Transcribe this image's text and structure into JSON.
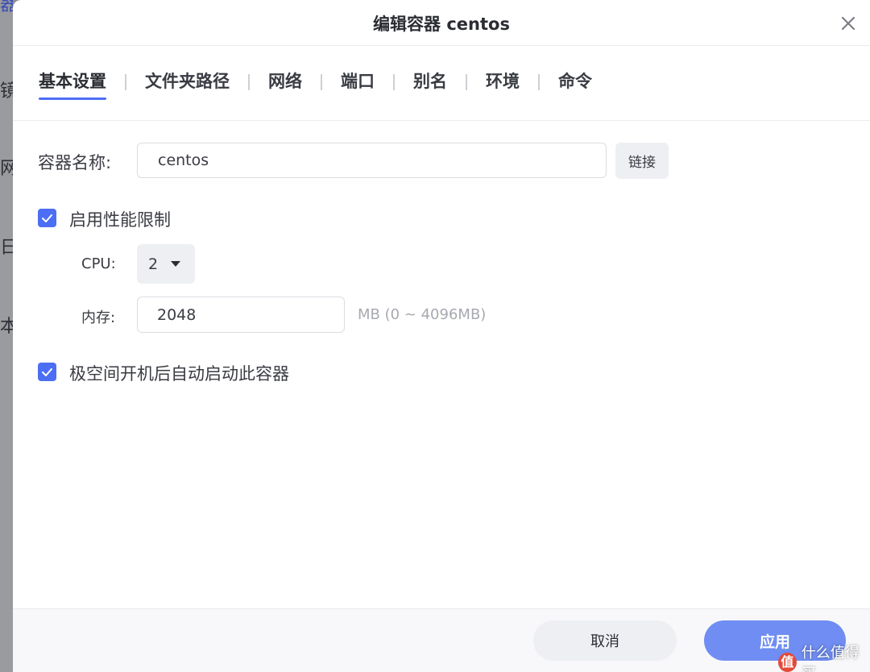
{
  "backdrop": {
    "chars": [
      "器",
      "镜",
      "网",
      "日",
      "本"
    ]
  },
  "dialog": {
    "title": "编辑容器 centos"
  },
  "tabs": [
    {
      "label": "基本设置",
      "active": true
    },
    {
      "label": "文件夹路径",
      "active": false
    },
    {
      "label": "网络",
      "active": false
    },
    {
      "label": "端口",
      "active": false
    },
    {
      "label": "别名",
      "active": false
    },
    {
      "label": "环境",
      "active": false
    },
    {
      "label": "命令",
      "active": false
    }
  ],
  "form": {
    "name_label": "容器名称:",
    "name_value": "centos",
    "link_button": "链接",
    "perf_limit_label": "启用性能限制",
    "perf_limit_checked": true,
    "cpu_label": "CPU:",
    "cpu_value": "2",
    "memory_label": "内存:",
    "memory_value": "2048",
    "memory_hint": "MB (0 ~ 4096MB)",
    "autostart_label": "极空间开机后自动启动此容器",
    "autostart_checked": true
  },
  "footer": {
    "cancel_label": "取消",
    "apply_label": "应用"
  },
  "watermark": {
    "badge": "值",
    "text": "什么值得买"
  },
  "colors": {
    "accent": "#4c6ef5",
    "apply_button": "#6f8df2",
    "overlay": "#8e8f93"
  }
}
